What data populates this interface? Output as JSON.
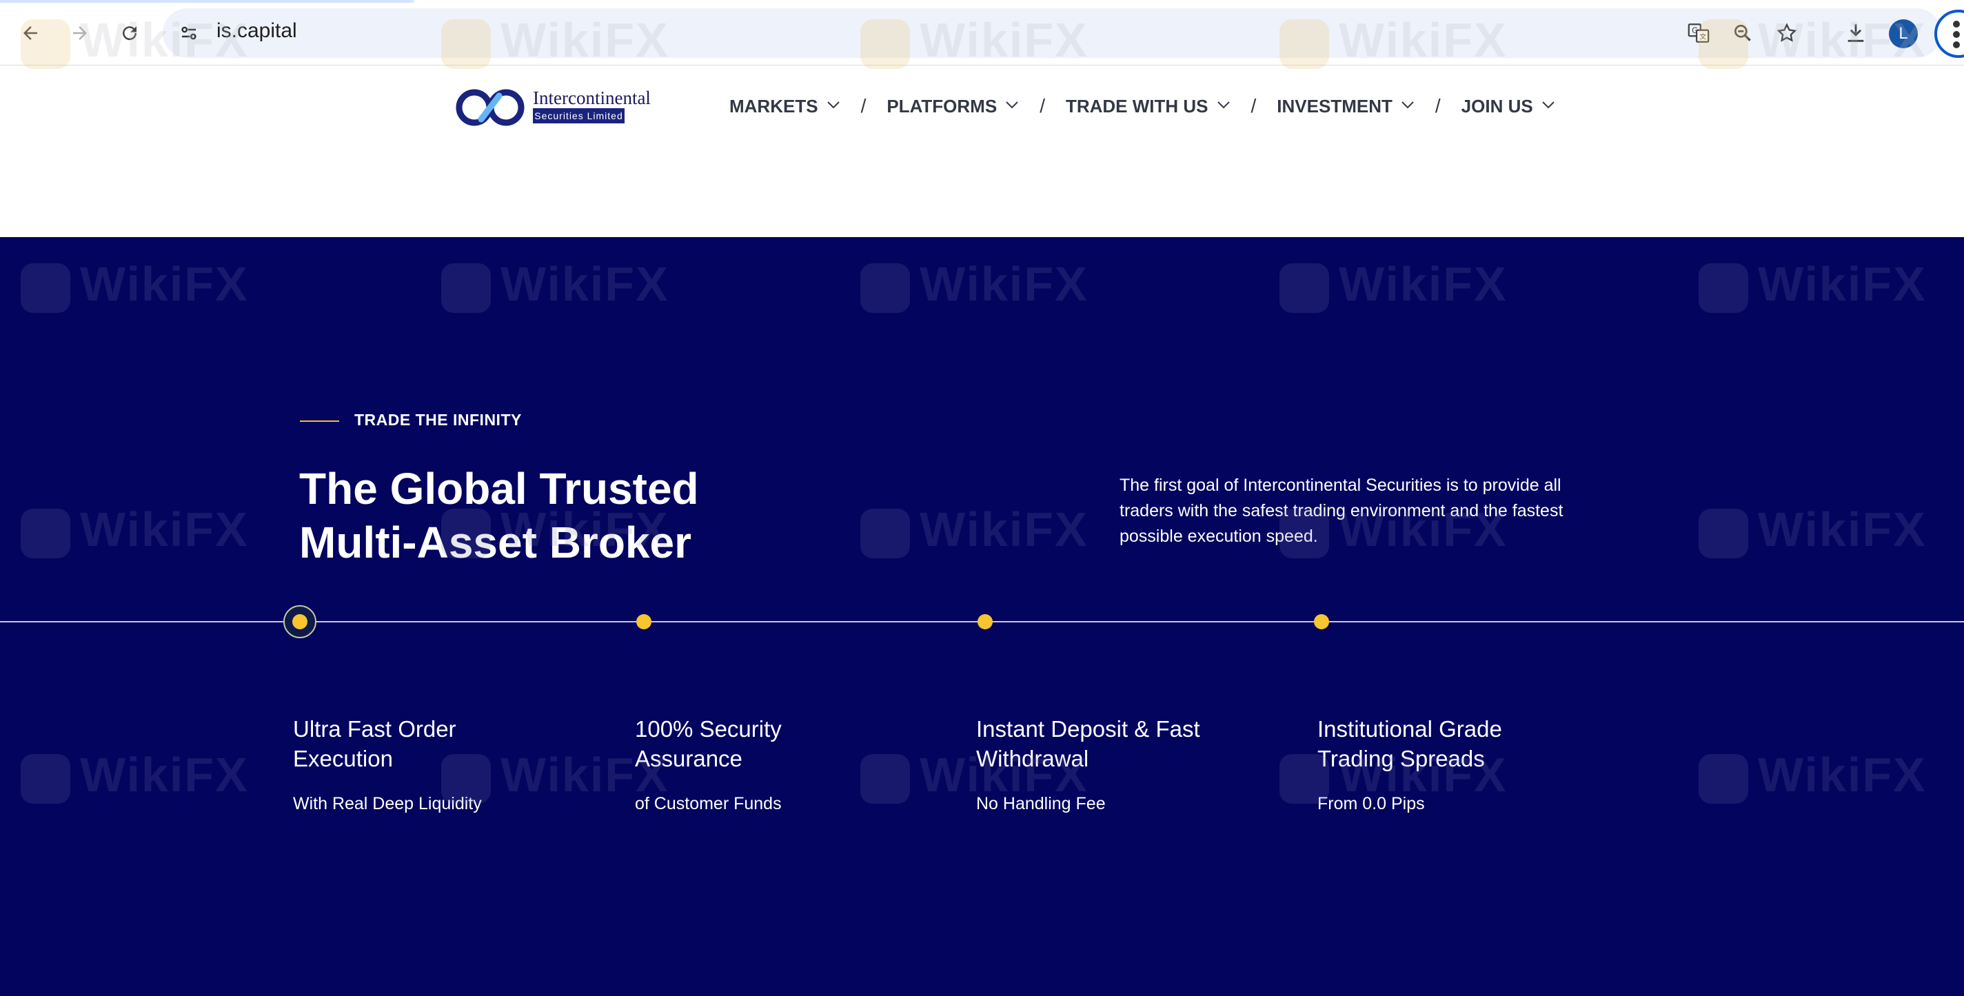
{
  "browser": {
    "url": "is.capital",
    "profile_initial": "L",
    "icons": [
      "back-icon",
      "forward-icon",
      "reload-icon",
      "site-settings-icon",
      "translate-icon",
      "zoom-icon",
      "bookmark-star-icon",
      "download-icon",
      "more-menu-icon"
    ]
  },
  "header": {
    "logo_name": "Intercontinental",
    "logo_sub": "Securities Limited",
    "menu": [
      {
        "label": "MARKETS"
      },
      {
        "label": "PLATFORMS"
      },
      {
        "label": "TRADE WITH US"
      },
      {
        "label": "INVESTMENT"
      },
      {
        "label": "JOIN US"
      }
    ],
    "separator": "/"
  },
  "hero": {
    "eyebrow": "TRADE THE INFINITY",
    "title_line1": "The Global Trusted",
    "title_line2": "Multi-Asset Broker",
    "description": "The first goal of Intercontinental Securities is to provide all traders with the safest trading environment and the fastest possible execution speed.",
    "features": [
      {
        "title_line1": "Ultra Fast Order",
        "title_line2": "Execution",
        "subtitle": "With Real Deep Liquidity"
      },
      {
        "title_line1": "100% Security",
        "title_line2": "Assurance",
        "subtitle": "of Customer Funds"
      },
      {
        "title_line1": "Instant Deposit & Fast",
        "title_line2": "Withdrawal",
        "subtitle": "No Handling Fee"
      },
      {
        "title_line1": "Institutional Grade",
        "title_line2": "Trading Spreads",
        "subtitle": "From 0.0 Pips"
      }
    ]
  },
  "watermark": {
    "text": "WikiFX"
  },
  "colors": {
    "hero_bg": "#03045e",
    "accent_yellow": "#f7c530",
    "menu_text": "#333845"
  }
}
